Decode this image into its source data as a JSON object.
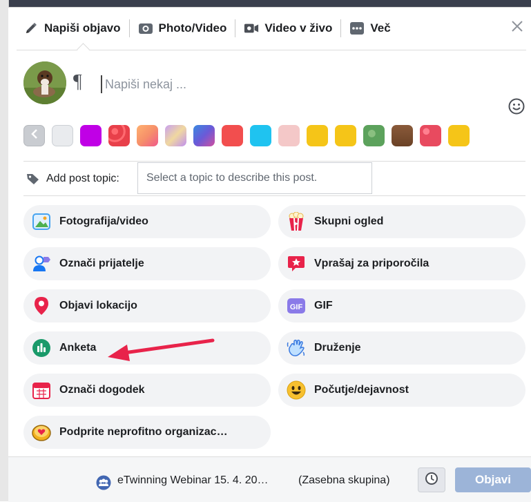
{
  "tabs": [
    {
      "label": "Napiši objavo",
      "icon": "pencil-icon"
    },
    {
      "label": "Photo/Video",
      "icon": "camera-icon"
    },
    {
      "label": "Video v živo",
      "icon": "live-video-icon"
    },
    {
      "label": "Več",
      "icon": "more-dots-icon"
    }
  ],
  "composer": {
    "placeholder": "Napiši nekaj ...",
    "format_glyph": "¶"
  },
  "backgrounds": {
    "colors": [
      "#c000e6",
      "#e8404a",
      "#f6906a",
      "#c8a0f0",
      "#6a5ad8",
      "#f24e4e",
      "#1fc3f0",
      "#f4c8c8",
      "#f5c518",
      "#f5c518",
      "#5ca25c",
      "#6b4226",
      "#e84a5f",
      "#f5c518"
    ]
  },
  "topic": {
    "label": "Add post topic:",
    "placeholder": "Select a topic to describe this post."
  },
  "actions": [
    {
      "label": "Fotografija/video",
      "icon": "photo-icon"
    },
    {
      "label": "Skupni ogled",
      "icon": "popcorn-icon"
    },
    {
      "label": "Označi prijatelje",
      "icon": "tag-friends-icon"
    },
    {
      "label": "Vprašaj za priporočila",
      "icon": "star-bubble-icon"
    },
    {
      "label": "Objavi lokacijo",
      "icon": "location-pin-icon"
    },
    {
      "label": "GIF",
      "icon": "gif-icon"
    },
    {
      "label": "Anketa",
      "icon": "poll-icon"
    },
    {
      "label": "Druženje",
      "icon": "waving-hand-icon"
    },
    {
      "label": "Označi dogodek",
      "icon": "calendar-icon"
    },
    {
      "label": "Počutje/dejavnost",
      "icon": "smiley-icon"
    },
    {
      "label": "Podprite neprofitno organizac…",
      "icon": "heart-coin-icon"
    }
  ],
  "footer": {
    "group_name": "eTwinning Webinar 15. 4. 20…",
    "privacy": "(Zasebna skupina)",
    "post_label": "Objavi"
  },
  "colors": {
    "accent": "#4267b2",
    "post_button": "#9cb4d8",
    "arrow": "#e8234a"
  }
}
